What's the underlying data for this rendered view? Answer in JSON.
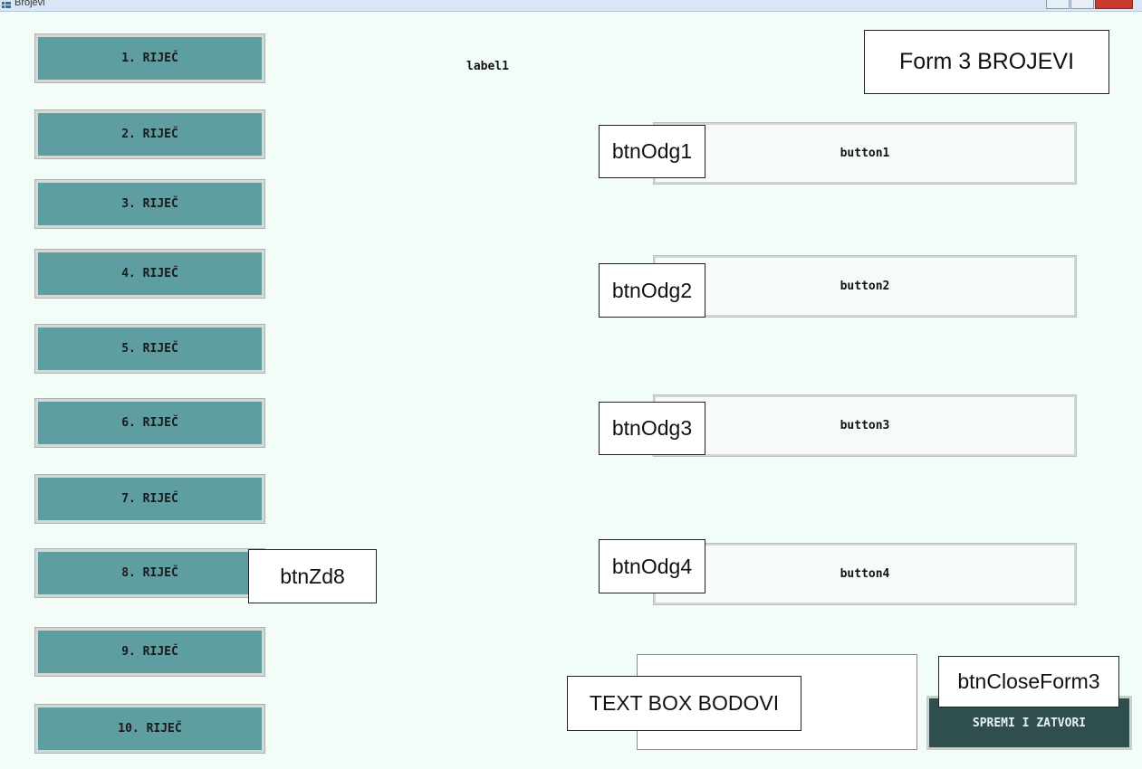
{
  "window": {
    "title": "Brojevi"
  },
  "form_caption": "Form 3 BROJEVI",
  "label1": "label1",
  "word_buttons": [
    "1. RIJEČ",
    "2. RIJEČ",
    "3. RIJEČ",
    "4. RIJEČ",
    "5. RIJEČ",
    "6. RIJEČ",
    "7. RIJEČ",
    "8. RIJEČ",
    "9. RIJEČ",
    "10. RIJEČ"
  ],
  "answer_buttons": [
    "button1",
    "button2",
    "button3",
    "button4"
  ],
  "callouts": {
    "btnZd8": "btnZd8",
    "btnOdg1": "btnOdg1",
    "btnOdg2": "btnOdg2",
    "btnOdg3": "btnOdg3",
    "btnOdg4": "btnOdg4",
    "text_box": "TEXT BOX BODOVI",
    "btnCloseForm3": "btnCloseForm3"
  },
  "save_button": "SPREMI I ZATVORI",
  "colors": {
    "word_button": "#5f9ea0",
    "save_button": "#2f4f4f",
    "form_background": "#f3fdf8"
  }
}
